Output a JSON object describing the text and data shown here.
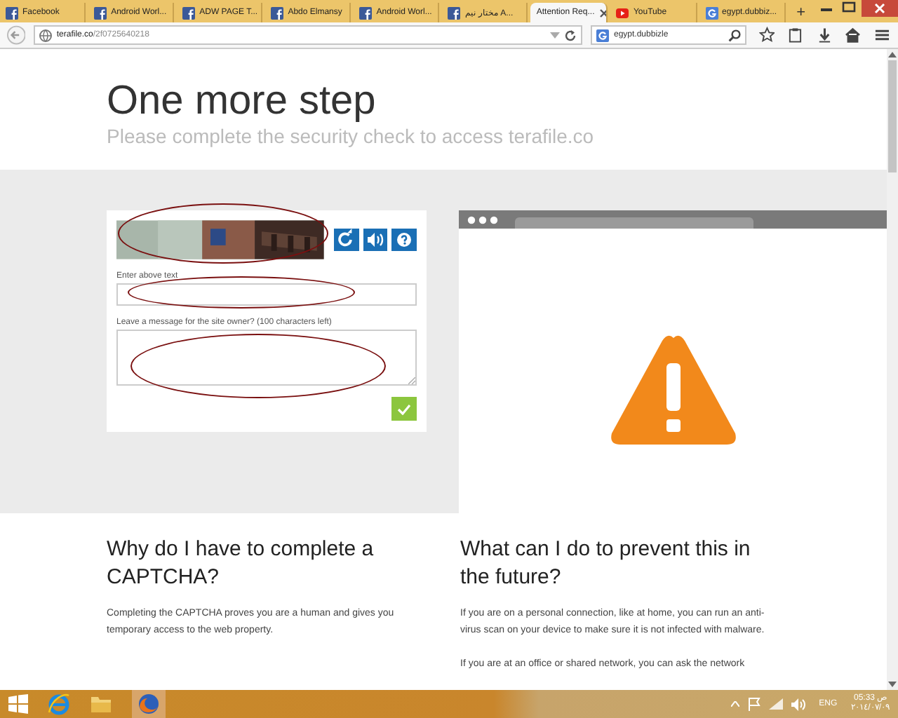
{
  "browser": {
    "tabs": [
      {
        "label": "Facebook",
        "kind": "facebook",
        "selected": false,
        "closable": false
      },
      {
        "label": "Android Worl...",
        "kind": "facebook",
        "selected": false,
        "closable": false
      },
      {
        "label": "ADW PAGE T...",
        "kind": "facebook",
        "selected": false,
        "closable": false
      },
      {
        "label": "Abdo Elmansy",
        "kind": "facebook",
        "selected": false,
        "closable": false
      },
      {
        "label": "Android Worl...",
        "kind": "facebook",
        "selected": false,
        "closable": false
      },
      {
        "label": "مختار نيم A...",
        "kind": "facebook",
        "selected": false,
        "closable": false
      },
      {
        "label": "Attention Req...",
        "kind": "plain",
        "selected": true,
        "closable": true
      },
      {
        "label": "YouTube",
        "kind": "youtube",
        "selected": false,
        "closable": false
      },
      {
        "label": "egypt.dubbiz...",
        "kind": "google",
        "selected": false,
        "closable": false
      }
    ],
    "new_tab": "+",
    "url": {
      "host": "terafile.co",
      "path": "/2f0725640218"
    },
    "search": {
      "value": "egypt.dubbizle"
    }
  },
  "page": {
    "title": "One more step",
    "subtitle": "Please complete the security check to access terafile.co",
    "form": {
      "answer_label": "Enter above text",
      "message_label": "Leave a message for the site owner? (100 characters left)"
    },
    "sections": [
      {
        "heading": "Why do I have to complete a CAPTCHA?",
        "paragraphs": [
          "Completing the CAPTCHA proves you are a human and gives you temporary access to the web property."
        ]
      },
      {
        "heading": "What can I do to prevent this in the future?",
        "paragraphs": [
          "If you are on a personal connection, like at home, you can run an anti-virus scan on your device to make sure it is not infected with malware.",
          "If you are at an office or shared network, you can ask the network"
        ]
      }
    ]
  },
  "taskbar": {
    "language": "ENG",
    "time": "05:33 ص",
    "date": "٢٠١٤/٠٧/٠٩"
  }
}
